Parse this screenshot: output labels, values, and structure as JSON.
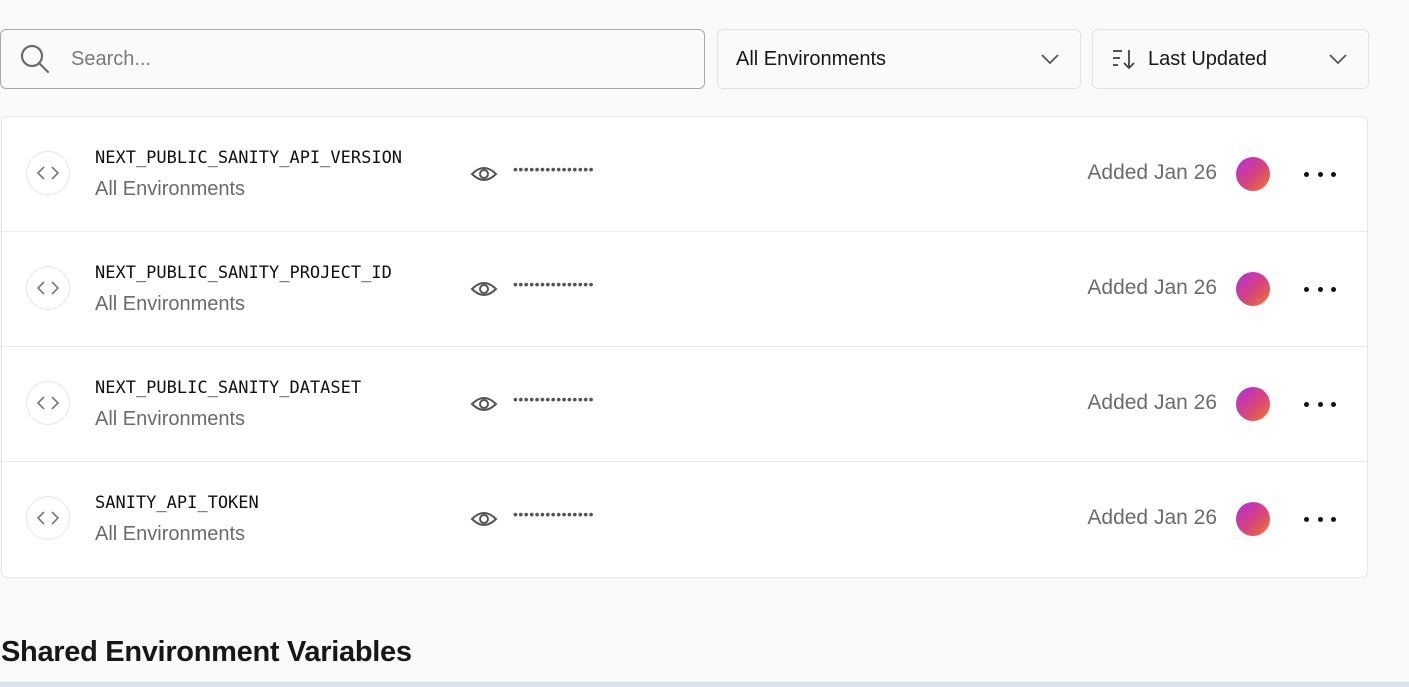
{
  "toolbar": {
    "search_placeholder": "Search...",
    "environment_filter": "All Environments",
    "sort_label": "Last Updated"
  },
  "variables": [
    {
      "name": "NEXT_PUBLIC_SANITY_API_VERSION",
      "environment": "All Environments",
      "masked_value": "•••••••••••••••",
      "added": "Added Jan 26"
    },
    {
      "name": "NEXT_PUBLIC_SANITY_PROJECT_ID",
      "environment": "All Environments",
      "masked_value": "•••••••••••••••",
      "added": "Added Jan 26"
    },
    {
      "name": "NEXT_PUBLIC_SANITY_DATASET",
      "environment": "All Environments",
      "masked_value": "•••••••••••••••",
      "added": "Added Jan 26"
    },
    {
      "name": "SANITY_API_TOKEN",
      "environment": "All Environments",
      "masked_value": "•••••••••••••••",
      "added": "Added Jan 26"
    }
  ],
  "shared_section": {
    "title": "Shared Environment Variables"
  },
  "colors": {
    "background": "#fafafa",
    "avatar_gradient_start": "#b62be0",
    "avatar_gradient_end": "#f07a2a"
  }
}
